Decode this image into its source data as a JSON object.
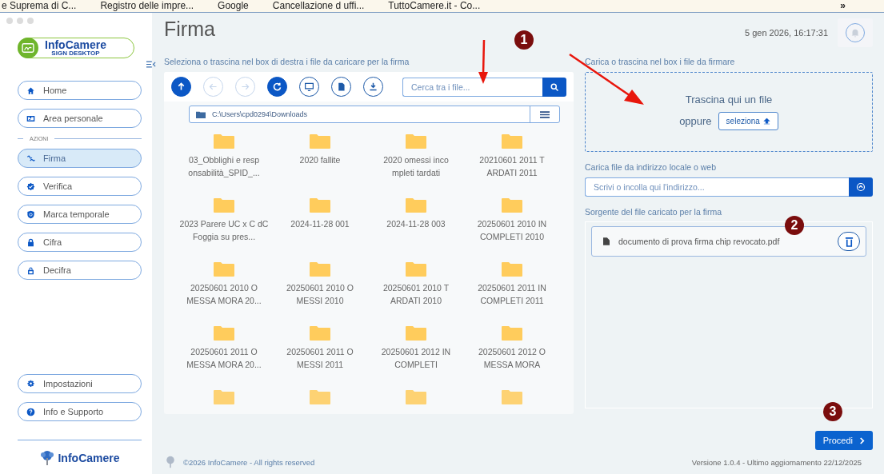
{
  "bookmarks": {
    "items": [
      {
        "label": "e Suprema di C..."
      },
      {
        "label": "Registro delle impre..."
      },
      {
        "label": "Google"
      },
      {
        "label": "Cancellazione d uffi..."
      },
      {
        "label": "TuttoCamere.it - Co..."
      }
    ],
    "more": "»"
  },
  "sidebar": {
    "logo": {
      "name": "InfoCamere",
      "subtitle": "SIGN DESKTOP"
    },
    "top_items": [
      {
        "label": "Home",
        "selected": false
      },
      {
        "label": "Area personale",
        "selected": false
      }
    ],
    "section_label": "AZIONI",
    "action_items": [
      {
        "label": "Firma",
        "selected": true
      },
      {
        "label": "Verifica",
        "selected": false
      },
      {
        "label": "Marca temporale",
        "selected": false
      },
      {
        "label": "Cifra",
        "selected": false
      },
      {
        "label": "Decifra",
        "selected": false
      }
    ],
    "bottom_items": [
      {
        "label": "Impostazioni",
        "selected": false
      },
      {
        "label": "Info e Supporto",
        "selected": false
      }
    ],
    "footer_logo": "InfoCamere"
  },
  "header": {
    "title": "Firma",
    "datetime": "5 gen 2026, 16:17:31"
  },
  "file_browser": {
    "hint": "Seleziona o trascina nel box di destra i file da caricare per la firma",
    "toolbar": [
      {
        "disabled": false
      },
      {
        "disabled": true
      },
      {
        "disabled": true
      },
      {
        "disabled": false
      },
      {
        "disabled": false
      },
      {
        "disabled": false
      },
      {
        "disabled": false
      }
    ],
    "search": {
      "placeholder": "Cerca tra i file..."
    },
    "path": "C:\\Users\\cpd0294\\Downloads",
    "folders": [
      {
        "name": "03_Obblighi e resp onsabilità_SPID_...",
        "faded": false
      },
      {
        "name": "2020 fallite",
        "faded": false
      },
      {
        "name": "2020 omessi inco mpleti tardati",
        "faded": false
      },
      {
        "name": "20210601 2011 T ARDATI 2011",
        "faded": false
      },
      {
        "name": "2023 Parere UC x C dC Foggia su pres...",
        "faded": false
      },
      {
        "name": "2024-11-28 001",
        "faded": false
      },
      {
        "name": "2024-11-28 003",
        "faded": false
      },
      {
        "name": "20250601 2010 IN COMPLETI 2010",
        "faded": false
      },
      {
        "name": "20250601 2010 O MESSA MORA 20...",
        "faded": false
      },
      {
        "name": "20250601 2010 O MESSI 2010",
        "faded": false
      },
      {
        "name": "20250601 2010 T ARDATI 2010",
        "faded": false
      },
      {
        "name": "20250601 2011 IN COMPLETI 2011",
        "faded": false
      },
      {
        "name": "20250601 2011 O MESSA MORA 20...",
        "faded": false
      },
      {
        "name": "20250601 2011 O MESSI 2011",
        "faded": false
      },
      {
        "name": "20250601 2012 IN COMPLETI",
        "faded": false
      },
      {
        "name": "20250601 2012 O MESSA MORA",
        "faded": false
      },
      {
        "faded": true
      },
      {
        "faded": true
      },
      {
        "faded": true
      },
      {
        "faded": true
      }
    ]
  },
  "upload": {
    "hint": "Carica o trascina nel box i file da firmare",
    "drop_text": "Trascina qui un file",
    "or_text": "oppure",
    "select_button": "seleziona",
    "url_label": "Carica file da indirizzo locale o web",
    "url_field": {
      "placeholder": "Scrivi o incolla qui l'indirizzo..."
    },
    "source_label": "Sorgente del file caricato per la firma",
    "files": [
      {
        "name": "documento di prova firma chip revocato.pdf"
      }
    ],
    "proceed_button": "Procedi"
  },
  "footer": {
    "copyright": "©2026 InfoCamere - All rights reserved",
    "version": "Versione 1.0.4 - Ultimo aggiornamento 22/12/2025"
  },
  "annotations": [
    {
      "label": "1"
    },
    {
      "label": "2"
    },
    {
      "label": "3"
    }
  ]
}
